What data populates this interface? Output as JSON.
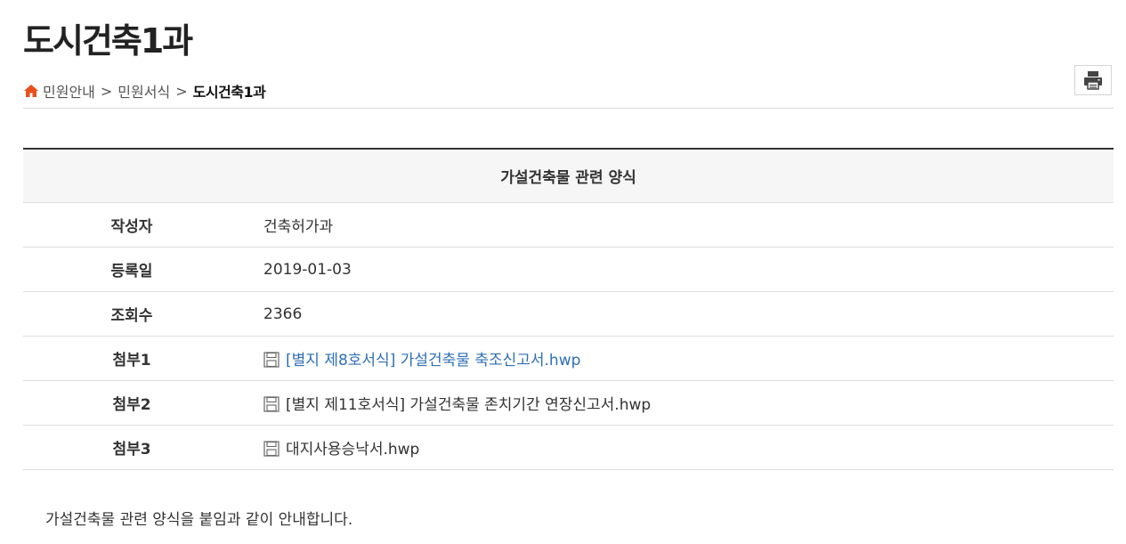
{
  "page": {
    "title": "도시건축1과"
  },
  "breadcrumb": {
    "items": [
      "민원안내",
      "민원서식"
    ],
    "separator": ">",
    "current": "도시건축1과"
  },
  "print_button": {
    "icon": "printer-icon"
  },
  "board": {
    "subject": "가설건축물 관련 양식",
    "fields": [
      {
        "label": "작성자",
        "value": "건축허가과"
      },
      {
        "label": "등록일",
        "value": "2019-01-03"
      },
      {
        "label": "조회수",
        "value": "2366"
      }
    ],
    "attachments": [
      {
        "label": "첨부1",
        "file": "[별지 제8호서식] 가설건축물 축조신고서.hwp",
        "icon": "save-disk-icon"
      },
      {
        "label": "첨부2",
        "file": "[별지 제11호서식] 가설건축물 존치기간 연장신고서.hwp",
        "icon": "save-disk-icon"
      },
      {
        "label": "첨부3",
        "file": "대지사용승낙서.hwp",
        "icon": "save-disk-icon"
      }
    ],
    "content": "가설건축물 관련 양식을 붙임과 같이 안내합니다."
  },
  "colors": {
    "home_icon": "#e8501e",
    "link_active": "#2f6fb5",
    "header_bg": "#f6f6f6"
  }
}
